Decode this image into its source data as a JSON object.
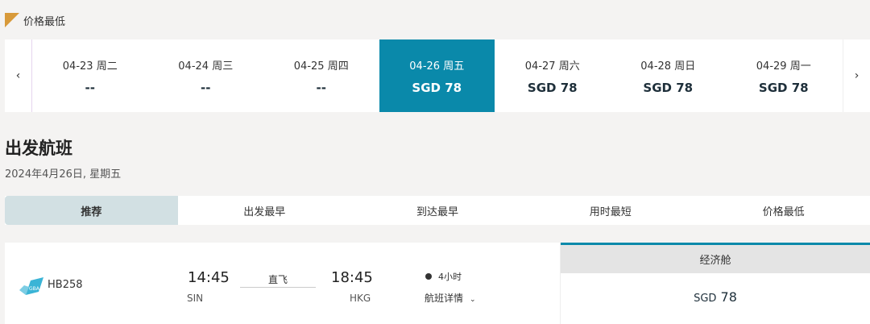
{
  "legend": {
    "label": "价格最低",
    "color": "#d89a3a"
  },
  "dates": {
    "prev_icon": "chevron-left-icon",
    "next_icon": "chevron-right-icon",
    "prev_glyph": "‹",
    "next_glyph": "›",
    "days": [
      {
        "date": "04-23 周二",
        "price": "--"
      },
      {
        "date": "04-24 周三",
        "price": "--"
      },
      {
        "date": "04-25 周四",
        "price": "--"
      },
      {
        "date": "04-26 周五",
        "price": "SGD 78",
        "selected": true
      },
      {
        "date": "04-27 周六",
        "price": "SGD 78"
      },
      {
        "date": "04-28 周日",
        "price": "SGD 78"
      },
      {
        "date": "04-29 周一",
        "price": "SGD 78"
      }
    ],
    "active_color": "#0a89aa"
  },
  "section": {
    "title": "出发航班",
    "date": "2024年4月26日, 星期五"
  },
  "sort_tabs": [
    {
      "label": "推荐",
      "active": true
    },
    {
      "label": "出发最早"
    },
    {
      "label": "到达最早"
    },
    {
      "label": "用时最短"
    },
    {
      "label": "价格最低"
    }
  ],
  "flight": {
    "airline_icon": "greater-bay-airlines-logo",
    "number": "HB258",
    "dep_time": "14:45",
    "dep_code": "SIN",
    "stop": "直飞",
    "arr_time": "18:45",
    "arr_code": "HKG",
    "duration": "4小时",
    "details": "航班详情",
    "fare": {
      "class": "经济舱",
      "currency": "SGD",
      "amount": "78"
    }
  }
}
